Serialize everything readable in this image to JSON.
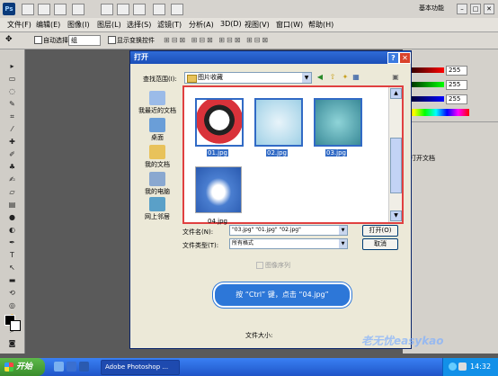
{
  "menubar": {
    "workspace": "基本功能",
    "menus": [
      "文件(F)",
      "编辑(E)",
      "图像(I)",
      "图层(L)",
      "选择(S)",
      "滤镜(T)",
      "分析(A)",
      "3D(D)",
      "视图(V)",
      "窗口(W)",
      "帮助(H)"
    ]
  },
  "optbar": {
    "auto_select": "自动选择:",
    "auto_select_value": "组",
    "show_transform": "显示变换控件"
  },
  "rpanel": {
    "values": [
      "255",
      "255",
      "255"
    ],
    "open_doc": "打开文档"
  },
  "dialog": {
    "title": "打开",
    "lookin_label": "查找范围(I):",
    "lookin_value": "图片收藏",
    "places": [
      "我最近的文档",
      "桌面",
      "我的文档",
      "我的电脑",
      "网上邻居"
    ],
    "files": [
      "01.jpg",
      "02.jpg",
      "03.jpg",
      "04.jpg"
    ],
    "filename_label": "文件名(N):",
    "filename_value": "\"03.jpg\" \"01.jpg\" \"02.jpg\"",
    "filetype_label": "文件类型(T):",
    "filetype_value": "所有格式",
    "open_btn": "打开(O)",
    "cancel_btn": "取消",
    "sequence": "图像序列",
    "callout": "按 “Ctrl” 键，点击 “04.jpg”",
    "filesize": "文件大小:"
  },
  "taskbar": {
    "start": "开始",
    "task": "Adobe Photoshop ...",
    "clock": "14:32"
  },
  "watermark": "老无忧easykao"
}
